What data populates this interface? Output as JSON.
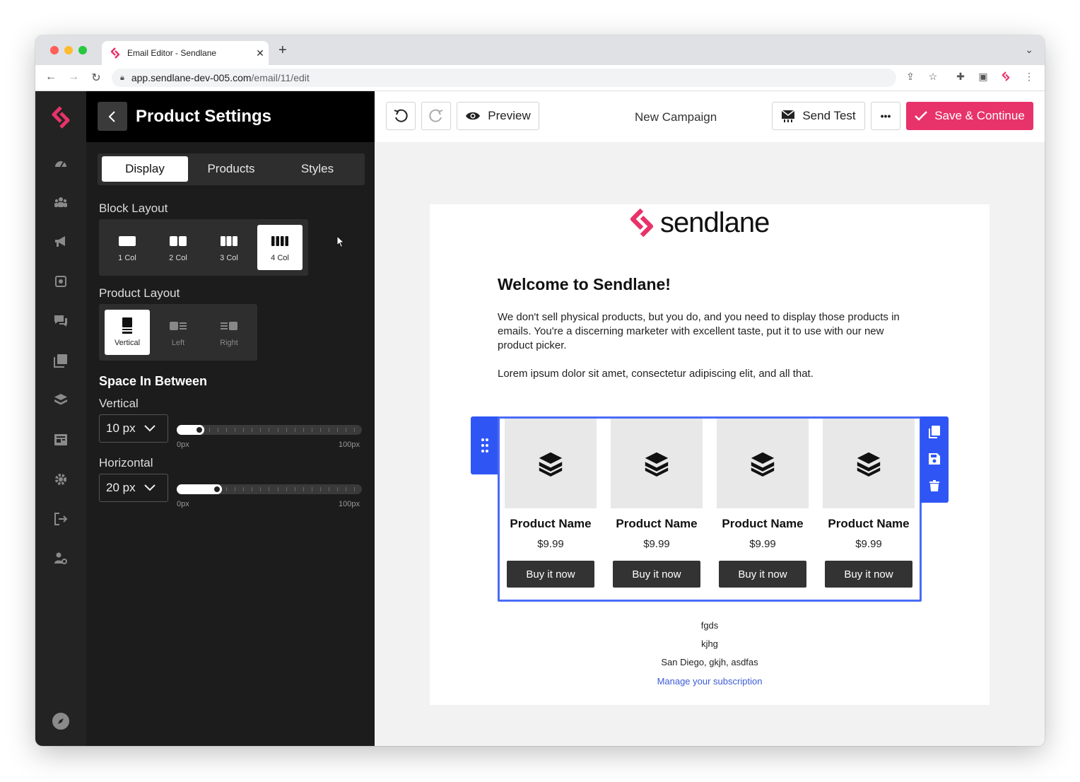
{
  "browser": {
    "tab_title": "Email Editor - Sendlane",
    "tab_close": "✕",
    "new_tab": "+",
    "url_host": "app.sendlane-dev-005.com",
    "url_path": "/email/11/edit"
  },
  "colors": {
    "brand": "#e8336a",
    "accent_blue": "#2f56f5",
    "sidebar_bg": "#1c1c1c"
  },
  "rail": {
    "icons": [
      "sendlane-logo-icon",
      "dashboard-icon",
      "contacts-icon",
      "campaigns-icon",
      "automations-icon",
      "conversations-icon",
      "media-icon",
      "products-icon",
      "forms-icon",
      "settings-icon",
      "logout-icon",
      "admin-icon",
      "compass-icon"
    ]
  },
  "panel": {
    "title": "Product Settings",
    "tabs": [
      {
        "label": "Display",
        "active": true
      },
      {
        "label": "Products",
        "active": false
      },
      {
        "label": "Styles",
        "active": false
      }
    ],
    "block_layout": {
      "label": "Block Layout",
      "options": [
        {
          "label": "1 Col",
          "active": false
        },
        {
          "label": "2 Col",
          "active": false
        },
        {
          "label": "3 Col",
          "active": false
        },
        {
          "label": "4 Col",
          "active": true
        }
      ]
    },
    "product_layout": {
      "label": "Product Layout",
      "options": [
        {
          "label": "Vertical",
          "active": true
        },
        {
          "label": "Left",
          "active": false
        },
        {
          "label": "Right",
          "active": false
        }
      ]
    },
    "space_in_between": {
      "title": "Space In Between",
      "vertical": {
        "label": "Vertical",
        "value": "10 px",
        "level": 0.1,
        "min": "0px",
        "max": "100px"
      },
      "horizontal": {
        "label": "Horizontal",
        "value": "20 px",
        "level": 0.2,
        "min": "0px",
        "max": "100px"
      }
    }
  },
  "topbar": {
    "preview_label": "Preview",
    "campaign_name": "New Campaign",
    "send_test_label": "Send Test",
    "more_label": "•••",
    "save_label": "Save & Continue"
  },
  "email": {
    "logo_text": "sendlane",
    "heading": "Welcome to Sendlane!",
    "paragraph1": "We don't sell physical products, but you do, and you need to display those products in emails. You're a discerning marketer with excellent taste, put it to use with our new product picker.",
    "paragraph2": "Lorem ipsum dolor sit amet, consectetur adipiscing elit, and all that.",
    "products": [
      {
        "name": "Product Name",
        "price": "$9.99",
        "button": "Buy it now"
      },
      {
        "name": "Product Name",
        "price": "$9.99",
        "button": "Buy it now"
      },
      {
        "name": "Product Name",
        "price": "$9.99",
        "button": "Buy it now"
      },
      {
        "name": "Product Name",
        "price": "$9.99",
        "button": "Buy it now"
      }
    ],
    "footer": {
      "line1": "fgds",
      "line2": "kjhg",
      "line3": "San Diego, gkjh, asdfas",
      "link": "Manage your subscription"
    }
  }
}
